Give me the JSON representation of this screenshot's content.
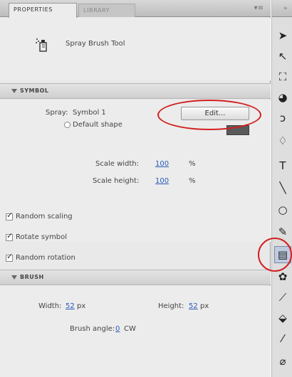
{
  "tabs": [
    {
      "label": "PROPERTIES",
      "active": true
    },
    {
      "label": "LIBRARY",
      "active": false
    }
  ],
  "panel_menu_icon": "panel-menu-icon",
  "tool": {
    "name": "Spray Brush Tool",
    "icon": "spray-brush-icon"
  },
  "symbol_section": {
    "header": "SYMBOL",
    "spray_label": "Spray:",
    "spray_value": "Symbol 1",
    "edit_label": "Edit...",
    "default_shape_label": "Default shape",
    "scale_width_label": "Scale width:",
    "scale_width_value": "100",
    "scale_height_label": "Scale height:",
    "scale_height_value": "100",
    "percent": "%",
    "random_scaling_label": "Random scaling",
    "rotate_symbol_label": "Rotate symbol",
    "random_rotation_label": "Random rotation"
  },
  "brush_section": {
    "header": "BRUSH",
    "width_label": "Width:",
    "width_value": "52",
    "height_label": "Height:",
    "height_value": "52",
    "px": "px",
    "angle_label": "Brush angle:",
    "angle_value": "0",
    "angle_unit": "CW"
  },
  "toolbar_tools": [
    {
      "icon": "selection-arrow-icon",
      "glyph": "➤",
      "active": false
    },
    {
      "icon": "subselection-arrow-icon",
      "glyph": "↖",
      "active": false
    },
    {
      "icon": "free-transform-icon",
      "glyph": "⛶",
      "active": false
    },
    {
      "icon": "3d-rotation-icon",
      "glyph": "◕",
      "active": false
    },
    {
      "icon": "lasso-icon",
      "glyph": "ↄ",
      "active": false
    },
    {
      "icon": "pen-icon",
      "glyph": "♢",
      "active": false
    },
    {
      "icon": "text-icon",
      "glyph": "T",
      "active": false
    },
    {
      "icon": "line-icon",
      "glyph": "╲",
      "active": false
    },
    {
      "icon": "rectangle-icon",
      "glyph": "○",
      "active": false
    },
    {
      "icon": "pencil-icon",
      "glyph": "✎",
      "active": false
    },
    {
      "icon": "spray-brush-icon",
      "glyph": "▤",
      "active": true
    },
    {
      "icon": "deco-icon",
      "glyph": "✿",
      "active": false
    },
    {
      "icon": "bone-icon",
      "glyph": "⟋",
      "active": false
    },
    {
      "icon": "paint-bucket-icon",
      "glyph": "⬙",
      "active": false
    },
    {
      "icon": "eyedropper-icon",
      "glyph": "⁄",
      "active": false
    },
    {
      "icon": "eraser-icon",
      "glyph": "⌀",
      "active": false
    }
  ],
  "colors": {
    "highlight": "#d32020",
    "link": "#2a5ab8",
    "swatch": "#5a5a5a"
  }
}
